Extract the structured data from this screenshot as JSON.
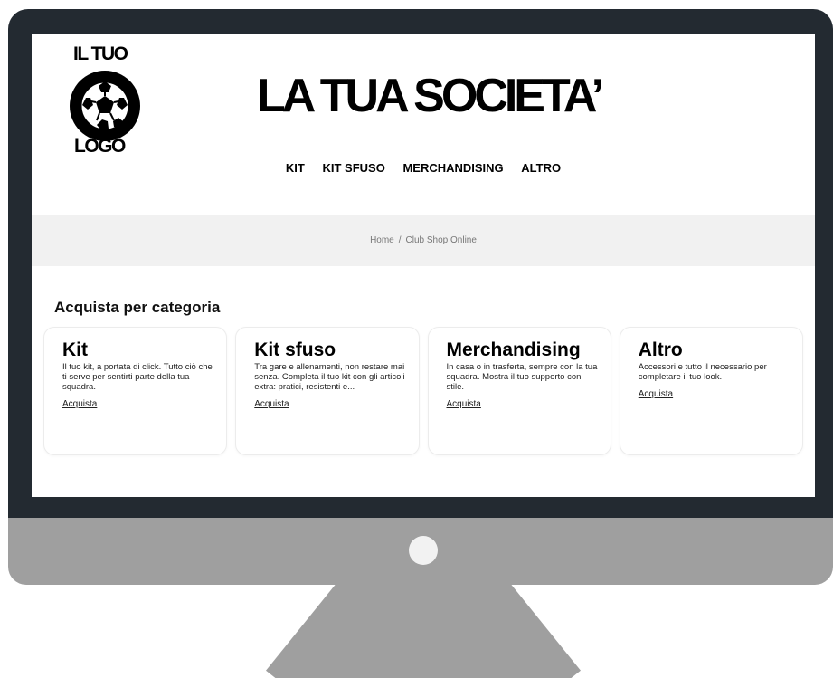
{
  "logo": {
    "top_text": "IL TUO",
    "bottom_text": "LOGO",
    "icon": "soccer-ball-icon"
  },
  "brand": {
    "title": "LA TUA SOCIETA’"
  },
  "nav": {
    "items": [
      "KIT",
      "KIT SFUSO",
      "MERCHANDISING",
      "ALTRO"
    ]
  },
  "breadcrumb": {
    "home": "Home",
    "separator": "/",
    "current": "Club Shop Online"
  },
  "categories": {
    "title": "Acquista per categoria",
    "cards": [
      {
        "title": "Kit",
        "description": "Il tuo kit, a portata di click. Tutto ciò che ti serve per sentirti parte della tua squadra.",
        "link": "Acquista"
      },
      {
        "title": "Kit sfuso",
        "description": "Tra gare e allenamenti, non restare mai senza. Completa il tuo kit con gli articoli extra: pratici, resistenti e...",
        "link": "Acquista"
      },
      {
        "title": "Merchandising",
        "description": "In casa o in trasferta, sempre con la tua squadra. Mostra il tuo supporto con stile.",
        "link": "Acquista"
      },
      {
        "title": "Altro",
        "description": "Accessori e tutto il necessario per completare il tuo look.",
        "link": "Acquista"
      }
    ]
  },
  "colors": {
    "monitor_bezel": "#232a31",
    "monitor_body": "#9f9f9f",
    "breadcrumb_band": "#f1f1f1",
    "text_primary": "#000000"
  }
}
